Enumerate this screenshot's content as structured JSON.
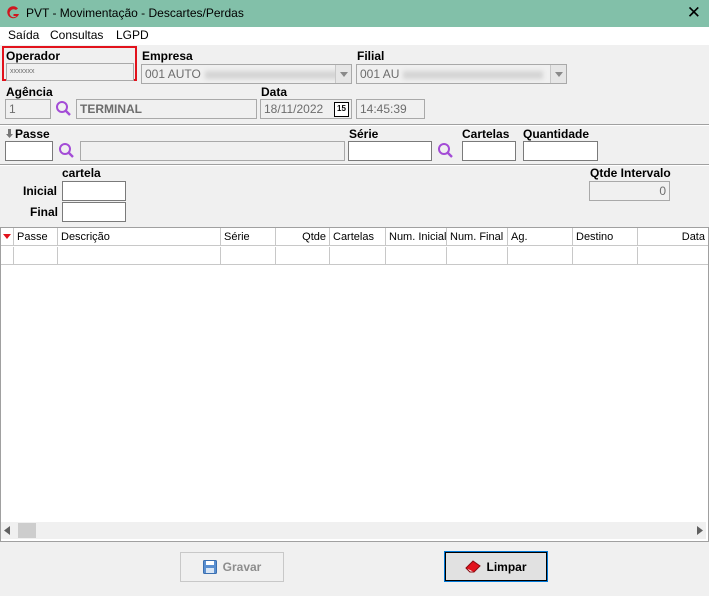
{
  "window": {
    "title": "PVT - Movimentação  - Descartes/Perdas",
    "accent": "#82c0a9"
  },
  "menu": [
    "Saída",
    "Consultas",
    "LGPD"
  ],
  "operador": {
    "label": "Operador",
    "value": "xxxxxxx"
  },
  "empresa": {
    "label": "Empresa",
    "value": "001 AUTO"
  },
  "filial": {
    "label": "Filial",
    "value": "001 AU"
  },
  "agencia": {
    "label": "Agência",
    "code": "1",
    "name": "TERMINAL"
  },
  "data": {
    "label": "Data",
    "date": "18/11/2022",
    "calendar_text": "15",
    "time": "14:45:39"
  },
  "passe": {
    "label": "Passe",
    "value": "",
    "desc": ""
  },
  "serie": {
    "label": "Série",
    "value": ""
  },
  "cartelas": {
    "label": "Cartelas",
    "value": ""
  },
  "quantidade": {
    "label": "Quantidade",
    "value": ""
  },
  "cartela": {
    "label": "cartela",
    "inicial_label": "Inicial",
    "final_label": "Final",
    "inicial": "",
    "final": ""
  },
  "qtde_intervalo": {
    "label": "Qtde Intervalo",
    "value": "0"
  },
  "grid": {
    "columns": [
      "Passe",
      "Descrição",
      "Série",
      "Qtde",
      "Cartelas",
      "Num. Inicial",
      "Num. Final",
      "Ag.",
      "Destino",
      "Data"
    ]
  },
  "buttons": {
    "gravar": "Gravar",
    "limpar": "Limpar"
  },
  "icons": {
    "app": "app-logo-icon",
    "close": "close-icon",
    "search": "search-icon",
    "calendar": "calendar-icon",
    "save": "save-icon",
    "eraser": "eraser-icon"
  }
}
